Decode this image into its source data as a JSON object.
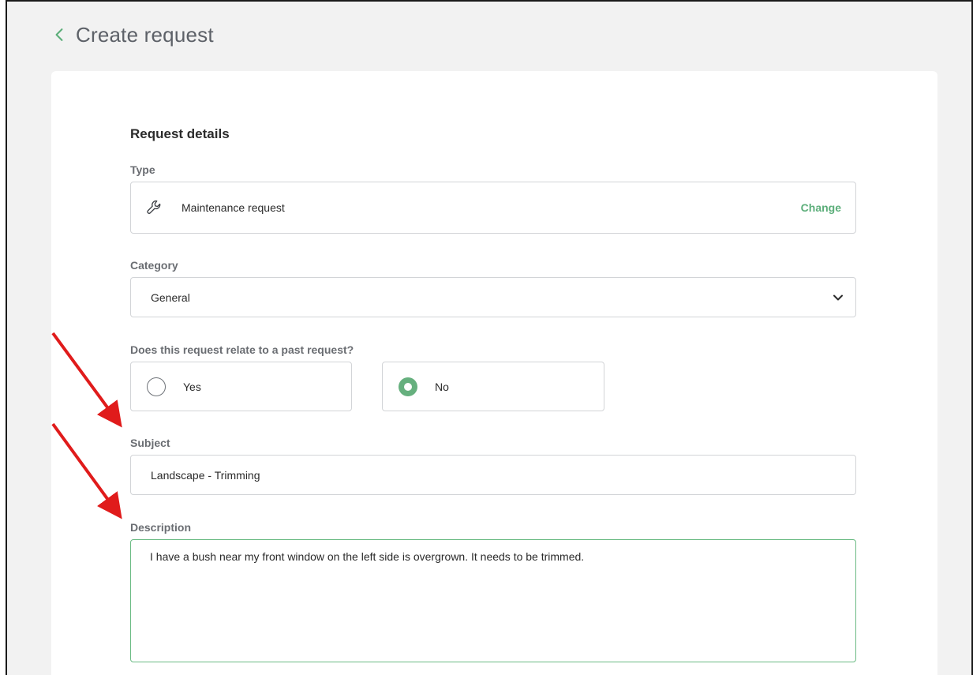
{
  "header": {
    "title": "Create request"
  },
  "form": {
    "section_title": "Request details",
    "type": {
      "label": "Type",
      "value": "Maintenance request",
      "icon": "wrench-icon",
      "change_label": "Change"
    },
    "category": {
      "label": "Category",
      "selected": "General"
    },
    "past_request": {
      "question": "Does this request relate to a past request?",
      "options": [
        {
          "label": "Yes",
          "selected": false
        },
        {
          "label": "No",
          "selected": true
        }
      ]
    },
    "subject": {
      "label": "Subject",
      "value": "Landscape - Trimming"
    },
    "description": {
      "label": "Description",
      "value": "I have a bush near my front window on the left side is overgrown. It needs to be trimmed."
    }
  },
  "colors": {
    "accent_green": "#5cae7a",
    "radio_selected": "#66b07e",
    "annotation_arrow": "#e01b1b",
    "page_background": "#f2f2f2"
  }
}
